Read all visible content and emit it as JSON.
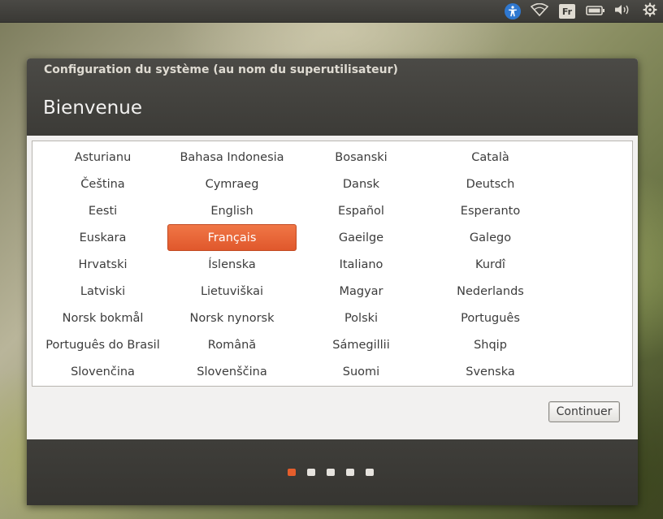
{
  "top_panel": {
    "indicators": [
      {
        "name": "accessibility-icon",
        "glyph": "♿"
      },
      {
        "name": "wifi-icon"
      },
      {
        "name": "keyboard-layout-icon",
        "label": "Fr"
      },
      {
        "name": "battery-icon"
      },
      {
        "name": "sound-icon"
      },
      {
        "name": "gear-icon"
      }
    ]
  },
  "window": {
    "title": "Configuration du système (au nom du superutilisateur)",
    "header": "Bienvenue",
    "languages": [
      "Asturianu",
      "Bahasa Indonesia",
      "Bosanski",
      "Català",
      "Čeština",
      "Cymraeg",
      "Dansk",
      "Deutsch",
      "Eesti",
      "English",
      "Español",
      "Esperanto",
      "Euskara",
      "Français",
      "Gaeilge",
      "Galego",
      "Hrvatski",
      "Íslenska",
      "Italiano",
      "Kurdî",
      "Latviski",
      "Lietuviškai",
      "Magyar",
      "Nederlands",
      "Norsk bokmål",
      "Norsk nynorsk",
      "Polski",
      "Português",
      "Português do Brasil",
      "Română",
      "Sámegillii",
      "Shqip",
      "Slovenčina",
      "Slovenščina",
      "Suomi",
      "Svenska"
    ],
    "selected_language": "Français",
    "continue_label": "Continuer",
    "steps": {
      "total": 5,
      "current": 1
    }
  },
  "colors": {
    "accent": "#e55e2c",
    "panel": "#3c3b37",
    "accessibility_blue": "#2f78d0"
  }
}
